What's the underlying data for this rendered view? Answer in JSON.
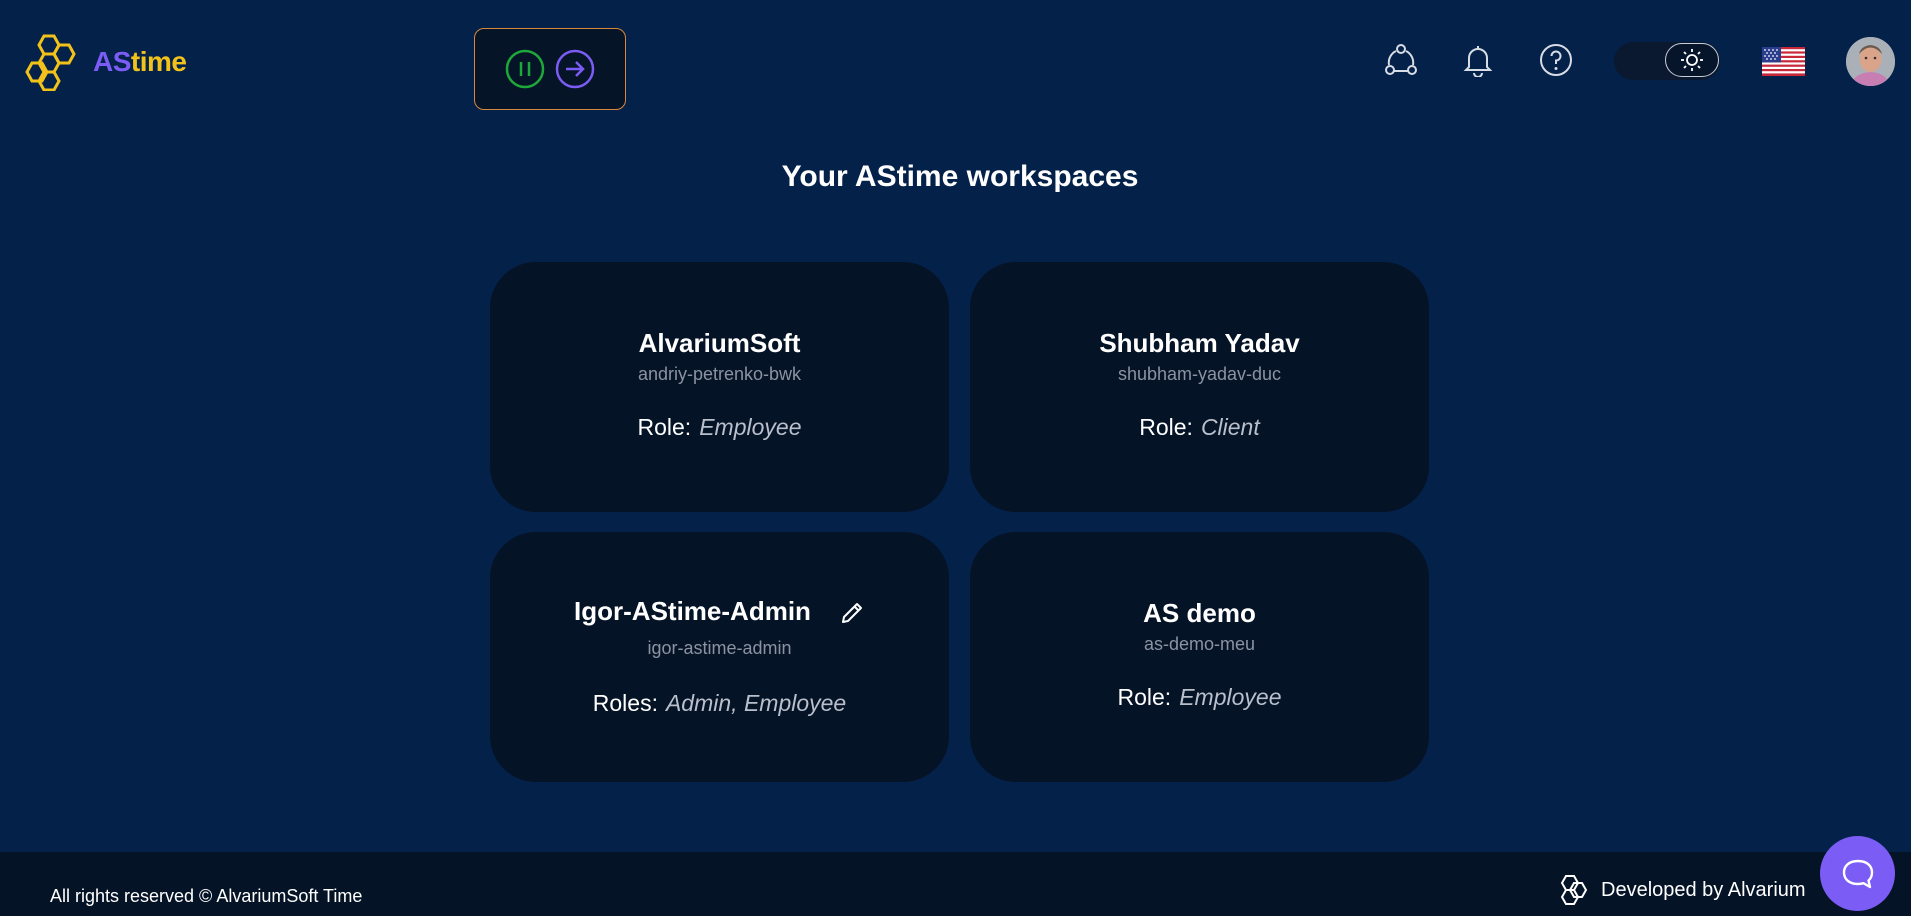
{
  "header": {
    "logo": {
      "as": "AS",
      "time": "time",
      "icon": "hexagon-logo-icon"
    },
    "timer": {
      "pause_icon": "pause-icon",
      "next_icon": "arrow-right-icon"
    },
    "icons": [
      "share-nodes-icon",
      "bell-icon",
      "help-circle-icon",
      "sun-icon"
    ],
    "language_flag": "us-flag-icon"
  },
  "page_title": "Your AStime workspaces",
  "workspaces": [
    {
      "name": "AlvariumSoft",
      "slug": "andriy-petrenko-bwk",
      "role_label": "Role:",
      "role_value": "Employee"
    },
    {
      "name": "Shubham Yadav",
      "slug": "shubham-yadav-duc",
      "role_label": "Role:",
      "role_value": "Client"
    },
    {
      "name": "Igor-AStime-Admin",
      "slug": "igor-astime-admin",
      "role_label": "Roles:",
      "role_value": "Admin, Employee"
    },
    {
      "name": "AS demo",
      "slug": "as-demo-meu",
      "role_label": "Role:",
      "role_value": "Employee"
    }
  ],
  "footer": {
    "copyright": "All rights reserved © AlvariumSoft Time",
    "developed_by": "Developed by Alvarium"
  },
  "colors": {
    "background": "#04214a",
    "card": "#051326",
    "accent_purple": "#7b5cf5",
    "accent_yellow": "#f2c21b",
    "timer_border": "#d9873b",
    "pause_green": "#1fa83a"
  }
}
